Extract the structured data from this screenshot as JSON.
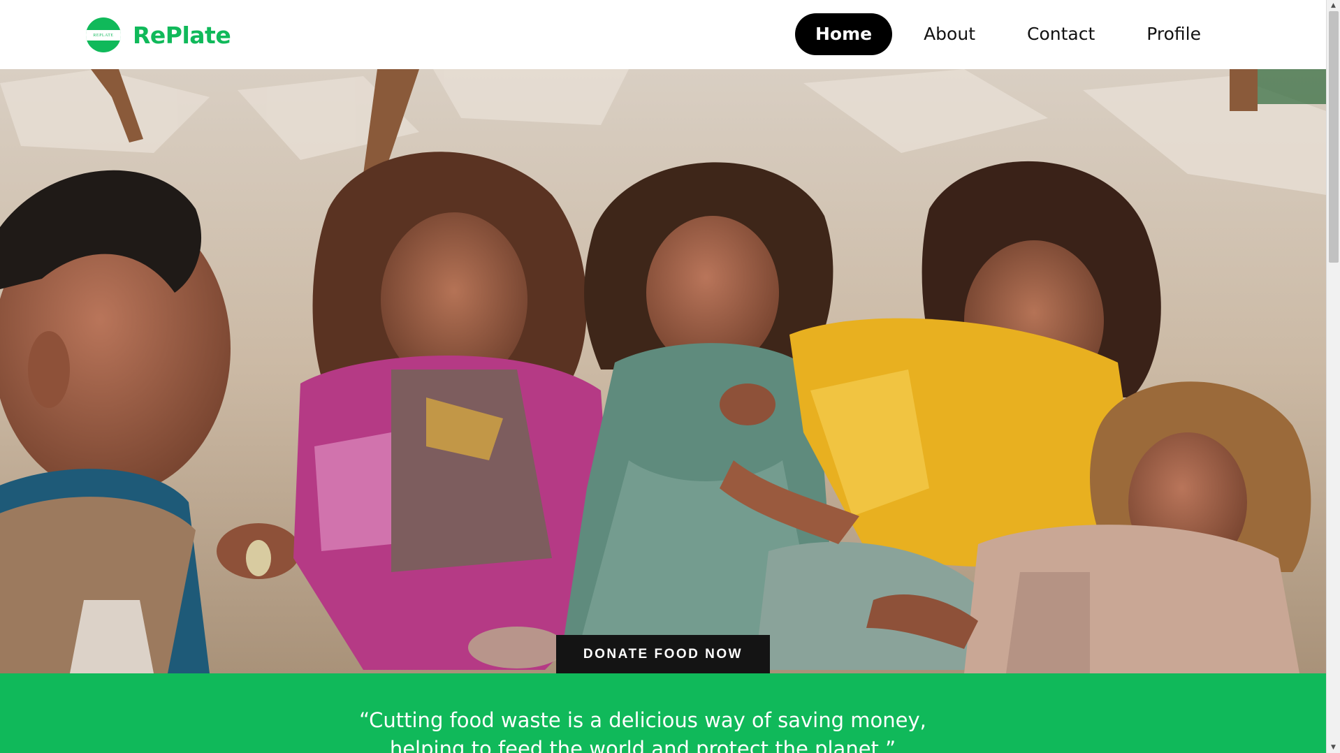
{
  "brand": {
    "name": "RePlate",
    "badge_text": "REPLATE",
    "color": "#10b95a"
  },
  "nav": {
    "items": [
      {
        "label": "Home",
        "active": true
      },
      {
        "label": "About",
        "active": false
      },
      {
        "label": "Contact",
        "active": false
      },
      {
        "label": "Profile",
        "active": false
      }
    ]
  },
  "hero": {
    "cta_label": "DONATE FOOD NOW"
  },
  "quote": {
    "line1": "“Cutting food waste is a delicious way of saving money,",
    "line2": "helping to feed the world and protect the planet.”"
  },
  "scrollbar": {
    "up_icon": "scroll-up-arrow-icon",
    "down_icon": "scroll-down-arrow-icon"
  }
}
